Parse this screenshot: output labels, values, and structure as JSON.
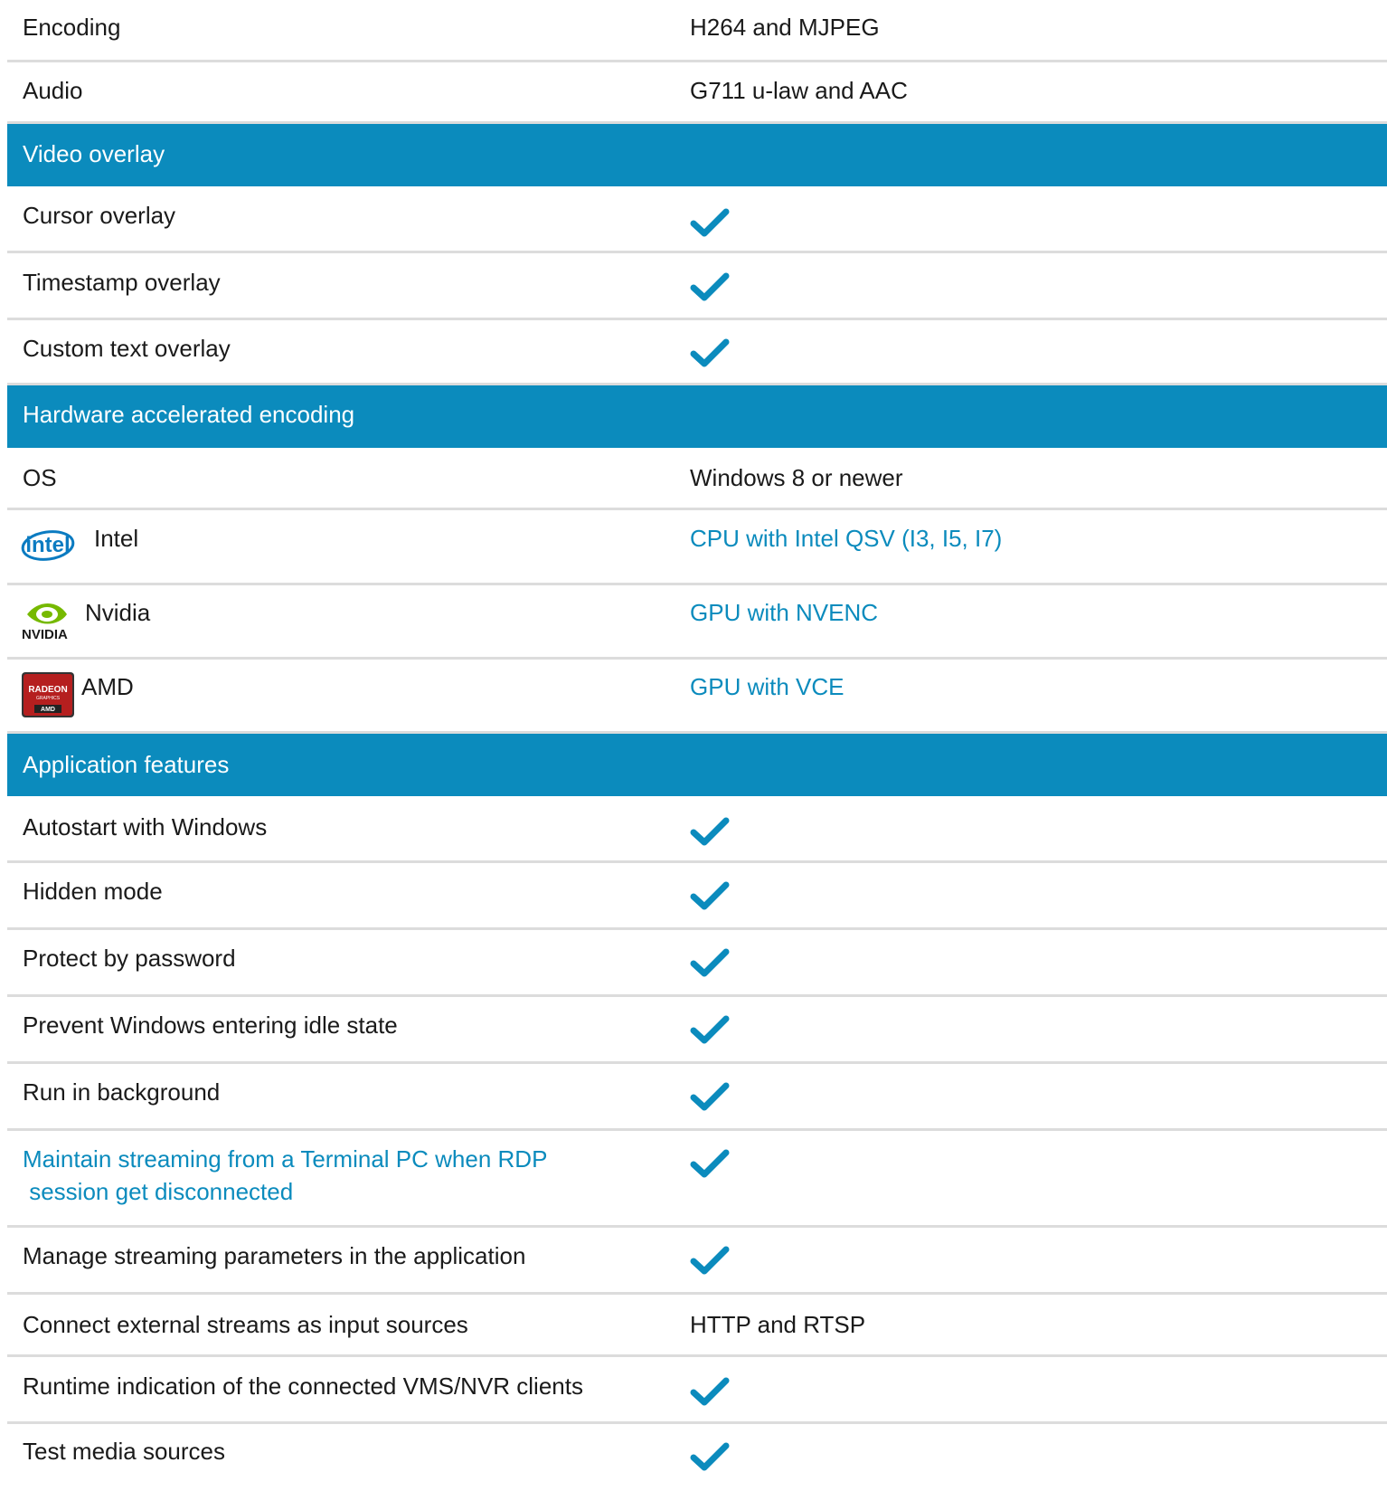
{
  "colors": {
    "header_bg": "#0b8bbd",
    "link": "#0b8bbd",
    "check": "#0b8bbd",
    "divider": "#dcdcdc"
  },
  "rows": {
    "encoding": {
      "label": "Encoding",
      "value": "H264 and MJPEG"
    },
    "audio": {
      "label": "Audio",
      "value": "G711 u-law and AAC"
    },
    "video_overlay_header": "Video overlay",
    "cursor_overlay": {
      "label": "Cursor overlay",
      "value_icon": "check-icon"
    },
    "timestamp_overlay": {
      "label": "Timestamp overlay",
      "value_icon": "check-icon"
    },
    "custom_text_overlay": {
      "label": "Custom text overlay",
      "value_icon": "check-icon"
    },
    "hw_header": "Hardware accelerated encoding",
    "os": {
      "label": "OS",
      "value": "Windows 8 or newer"
    },
    "intel": {
      "label": "Intel",
      "logo_text": "intel",
      "value": "CPU with Intel QSV (I3, I5, I7)"
    },
    "nvidia": {
      "label": "Nvidia",
      "logo_text": "NVIDIA",
      "value": "GPU with NVENC"
    },
    "amd": {
      "label": "AMD",
      "logo_text_1": "RADEON",
      "logo_text_2": "GRAPHICS",
      "logo_text_3": "AMD",
      "value": "GPU with VCE"
    },
    "app_header": "Application features",
    "autostart": {
      "label": "Autostart with Windows",
      "value_icon": "check-icon"
    },
    "hidden_mode": {
      "label": "Hidden mode",
      "value_icon": "check-icon"
    },
    "protect": {
      "label": "Protect by password",
      "value_icon": "check-icon"
    },
    "prevent_idle": {
      "label": "Prevent Windows entering idle state",
      "value_icon": "check-icon"
    },
    "background": {
      "label": "Run in background",
      "value_icon": "check-icon"
    },
    "rdp": {
      "label_line1": "Maintain streaming from a Terminal PC when RDP",
      "label_line2": " session get disconnected",
      "value_icon": "check-icon"
    },
    "manage_params": {
      "label": "Manage streaming parameters in the application",
      "value_icon": "check-icon"
    },
    "external_streams": {
      "label": "Connect external streams as input sources",
      "value": "HTTP and RTSP"
    },
    "runtime_indication": {
      "label": "Runtime indication of the connected VMS/NVR clients",
      "value_icon": "check-icon"
    },
    "test_media": {
      "label": "Test media sources",
      "value_icon": "check-icon"
    }
  }
}
